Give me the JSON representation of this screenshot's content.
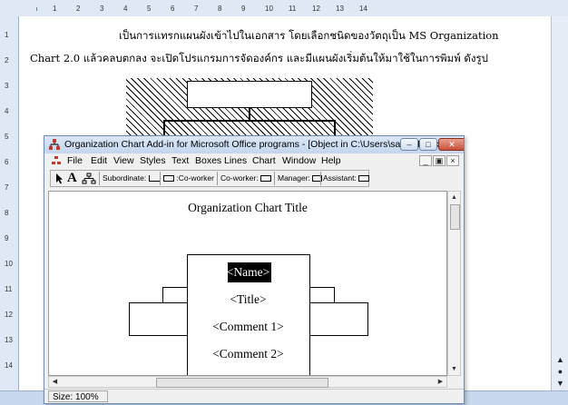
{
  "word": {
    "paragraph_line1": "เป็นการแทรกแผนผังเข้าไปในเอกสาร โดยเลือกชนิดของวัตถุเป็น MS Organization",
    "paragraph_line2": "Chart 2.0 แล้วคลบตกลง จะเปิดโปรแกรมการจัดองค์กร และมีแผนผังเริ่มต้นให้มาใช้ในการพิมพ์ ดังรูป",
    "ruler_numbers": [
      "1",
      "2",
      "3",
      "4",
      "5",
      "6",
      "7",
      "8",
      "9",
      "10",
      "11",
      "12",
      "13",
      "14"
    ],
    "left_ruler_numbers": [
      "1",
      "2",
      "3",
      "4",
      "5",
      "6",
      "7",
      "8",
      "9",
      "10",
      "11",
      "12",
      "13",
      "14"
    ]
  },
  "window": {
    "title": "Organization Chart Add-in for Microsoft Office programs - [Object in C:\\Users\\saksit\\Deskt...",
    "minimize_icon": "minimize-icon",
    "maximize_icon": "maximize-icon",
    "close_icon": "close-icon"
  },
  "menu": [
    "File",
    "Edit",
    "View",
    "Styles",
    "Text",
    "Boxes",
    "Lines",
    "Chart",
    "Window",
    "Help"
  ],
  "toolbar": {
    "subordinate": "Subordinate:",
    "coworker_left": ":Co-worker",
    "coworker_right": "Co-worker:",
    "manager": "Manager:",
    "assistant": "Assistant:"
  },
  "chart": {
    "title": "Organization Chart Title",
    "name": "<Name>",
    "role_title": "<Title>",
    "comment1": "<Comment 1>",
    "comment2": "<Comment 2>"
  },
  "status": {
    "size": "Size: 100%"
  }
}
